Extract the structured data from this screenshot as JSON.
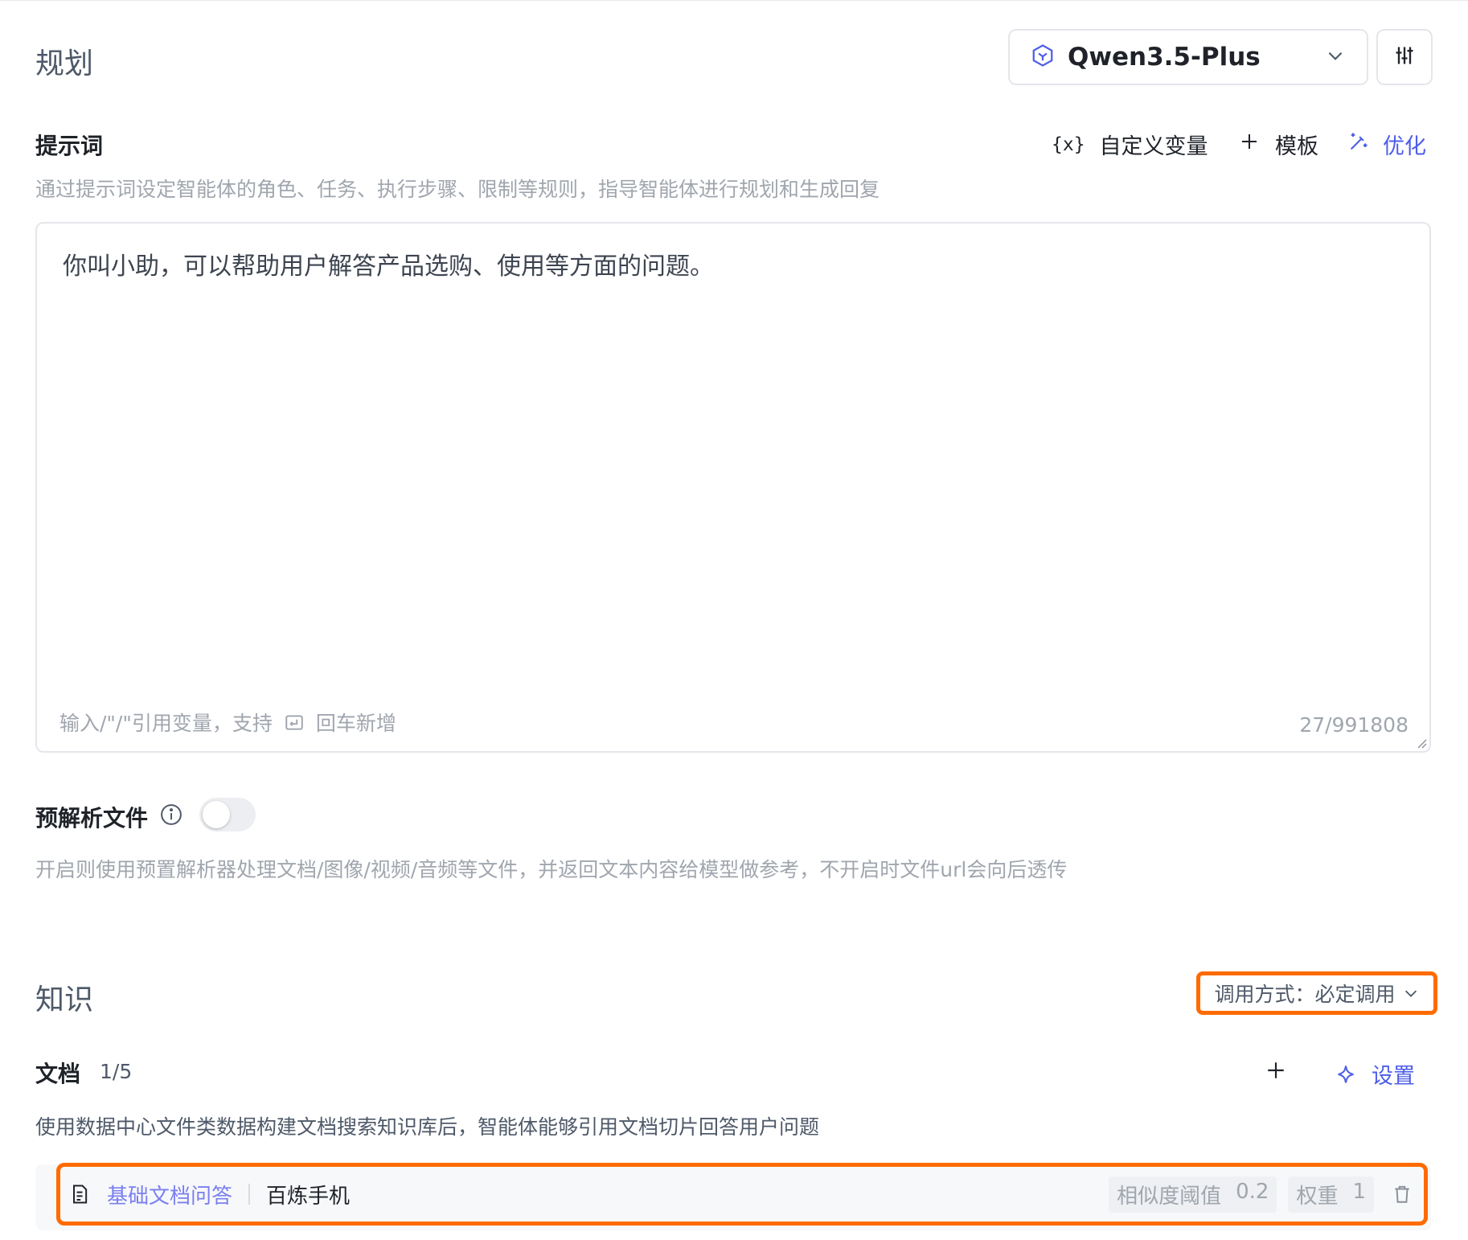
{
  "planning": {
    "title": "规划",
    "model": "Qwen3.5-Plus"
  },
  "prompt": {
    "label": "提示词",
    "custom_var_label": "自定义变量",
    "custom_var_icon": "{x}",
    "template_label": "模板",
    "optimize_label": "优化",
    "description": "通过提示词设定智能体的角色、任务、执行步骤、限制等规则，指导智能体进行规划和生成回复",
    "value": "你叫小助，可以帮助用户解答产品选购、使用等方面的问题。",
    "hint_prefix": "输入/\"/\"引用变量，支持",
    "hint_suffix": "回车新增",
    "count": "27/991808"
  },
  "preparse": {
    "label": "预解析文件",
    "enabled": false,
    "description": "开启则使用预置解析器处理文档/图像/视频/音频等文件，并返回文本内容给模型做参考，不开启时文件url会向后透传"
  },
  "knowledge": {
    "title": "知识",
    "invoke_mode": "调用方式：必定调用",
    "docs": {
      "label": "文档",
      "count": "1/5",
      "settings_label": "设置",
      "description": "使用数据中心文件类数据构建文档搜索知识库后，智能体能够引用文档切片回答用户问题",
      "items": [
        {
          "type": "基础文档问答",
          "name": "百炼手机",
          "similarity_label": "相似度阈值",
          "similarity_value": "0.2",
          "weight_label": "权重",
          "weight_value": "1"
        }
      ]
    }
  },
  "colors": {
    "accent": "#4e5ee8",
    "highlight": "#ff6b00"
  }
}
